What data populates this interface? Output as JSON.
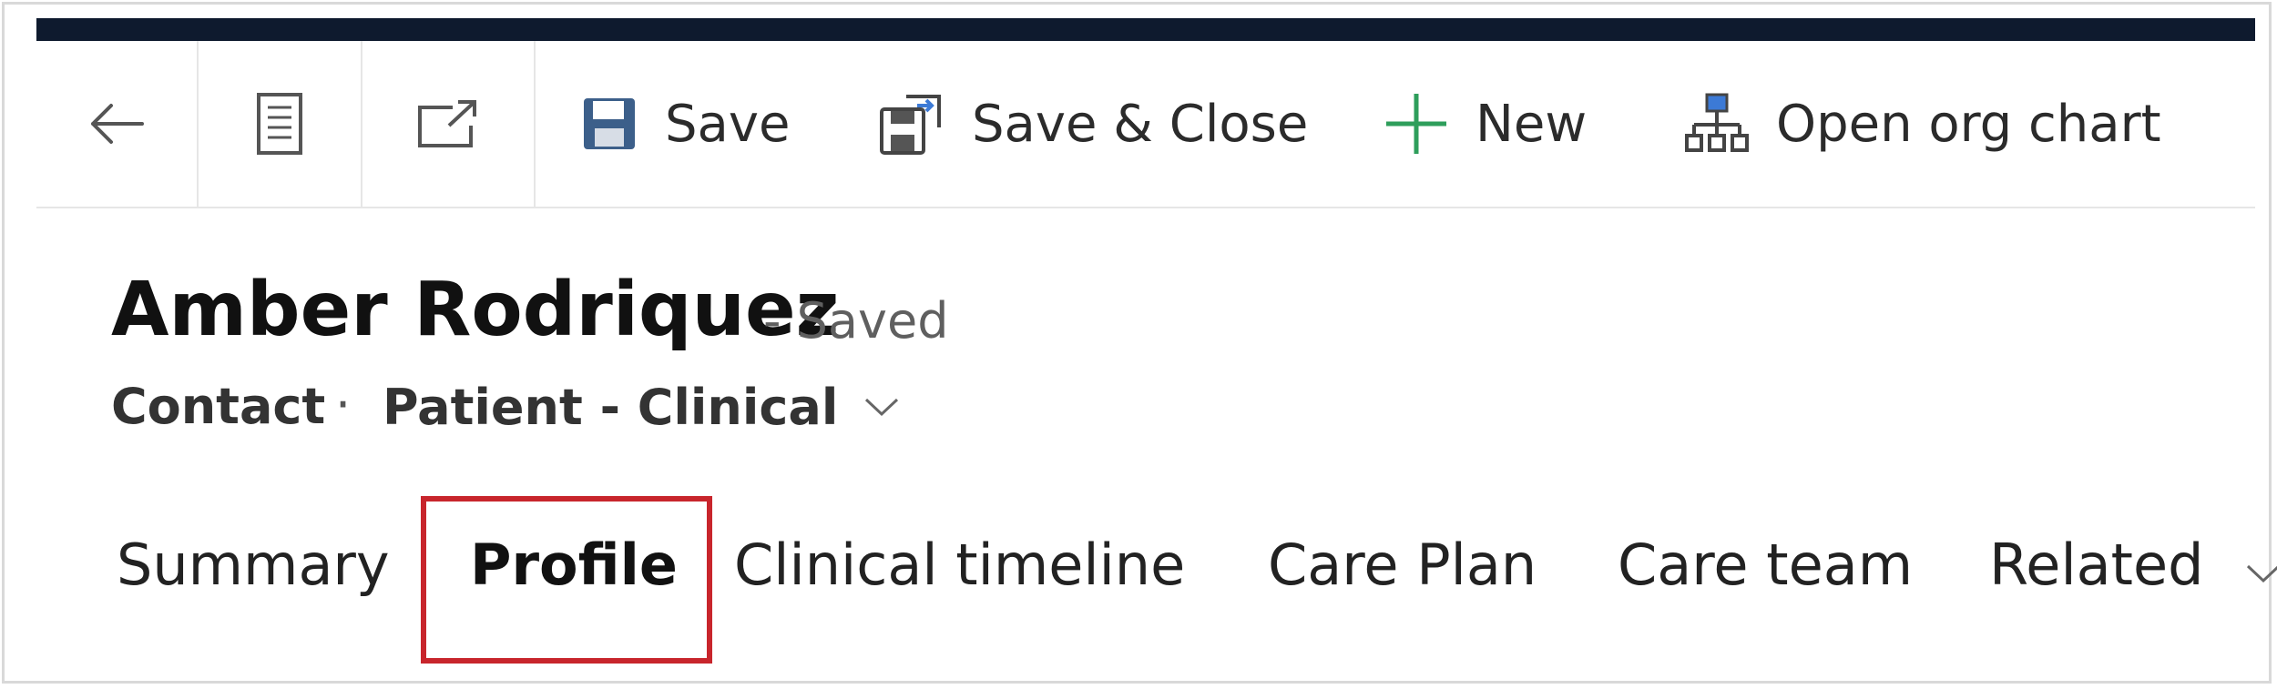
{
  "command_bar": {
    "back_icon": "arrow-left-icon",
    "record_set_icon": "list-document-icon",
    "popout_icon": "open-in-new-window-icon",
    "items": [
      {
        "label": "Save",
        "icon": "save-icon"
      },
      {
        "label": "Save & Close",
        "icon": "save-and-close-icon"
      },
      {
        "label": "New",
        "icon": "plus-icon"
      },
      {
        "label": "Open org chart",
        "icon": "org-chart-icon"
      }
    ]
  },
  "record": {
    "name": "Amber Rodriquez",
    "status": "- Saved",
    "entity": "Contact",
    "separator": "·",
    "form": "Patient - Clinical"
  },
  "tabs": [
    {
      "label": "Summary",
      "active": false
    },
    {
      "label": "Profile",
      "active": true
    },
    {
      "label": "Clinical timeline",
      "active": false
    },
    {
      "label": "Care Plan",
      "active": false
    },
    {
      "label": "Care team",
      "active": false
    },
    {
      "label": "Related",
      "active": false
    }
  ],
  "colors": {
    "top_bar": "#0e1a2e",
    "highlight": "#c8252c",
    "plus_icon": "#2e9e5b",
    "save_icon": "#3c5f8a"
  }
}
